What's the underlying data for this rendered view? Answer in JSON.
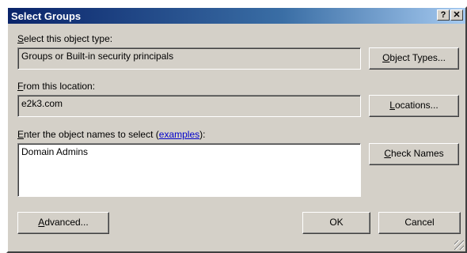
{
  "window": {
    "title": "Select Groups",
    "help_glyph": "?",
    "close_glyph": "✕"
  },
  "object_type": {
    "label_key": "S",
    "label_rest": "elect this object type:",
    "value": "Groups or Built-in security principals",
    "button_key": "O",
    "button_rest": "bject Types..."
  },
  "location": {
    "label_key": "F",
    "label_rest": "rom this location:",
    "value": "e2k3.com",
    "button_key": "L",
    "button_rest": "ocations..."
  },
  "names": {
    "label_key": "E",
    "label_mid": "nter the object names to select (",
    "link_text": "examples",
    "label_end": "):",
    "value": "Domain Admins",
    "check_key": "C",
    "check_rest": "heck Names"
  },
  "footer": {
    "advanced_key": "A",
    "advanced_rest": "dvanced...",
    "ok_label": "OK",
    "cancel_label": "Cancel"
  }
}
